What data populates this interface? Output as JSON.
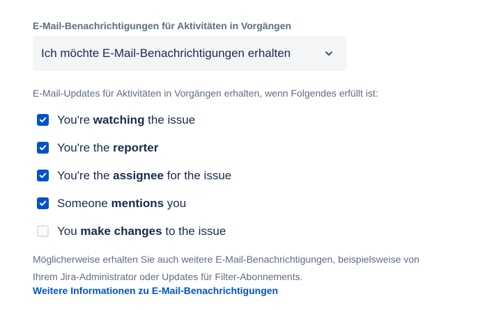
{
  "section_label": "E-Mail-Benachrichtigungen für Aktivitäten in Vorgängen",
  "select": {
    "value": "Ich möchte E-Mail-Benachrichtigungen erhalten"
  },
  "intro": "E-Mail-Updates für Aktivitäten in Vorgängen erhalten, wenn Folgendes erfüllt ist:",
  "options": [
    {
      "pre": "You're ",
      "bold": "watching",
      "post": " the issue",
      "checked": true
    },
    {
      "pre": "You're the ",
      "bold": "reporter",
      "post": "",
      "checked": true
    },
    {
      "pre": "You're the ",
      "bold": "assignee",
      "post": " for the issue",
      "checked": true
    },
    {
      "pre": "Someone ",
      "bold": "mentions",
      "post": " you",
      "checked": true
    },
    {
      "pre": "You ",
      "bold": "make changes",
      "post": " to the issue",
      "checked": false
    }
  ],
  "footer": {
    "line1": "Möglicherweise erhalten Sie auch weitere E-Mail-Benachrichtigungen, beispielsweise von",
    "line2": "Ihrem Jira-Administrator oder Updates für Filter-Abonnements.",
    "link": "Weitere Informationen zu E-Mail-Benachrichtigungen"
  },
  "colors": {
    "accent": "#0052cc",
    "text": "#172b4d",
    "muted": "#5e6c84",
    "select_bg": "#f4f5f7"
  }
}
